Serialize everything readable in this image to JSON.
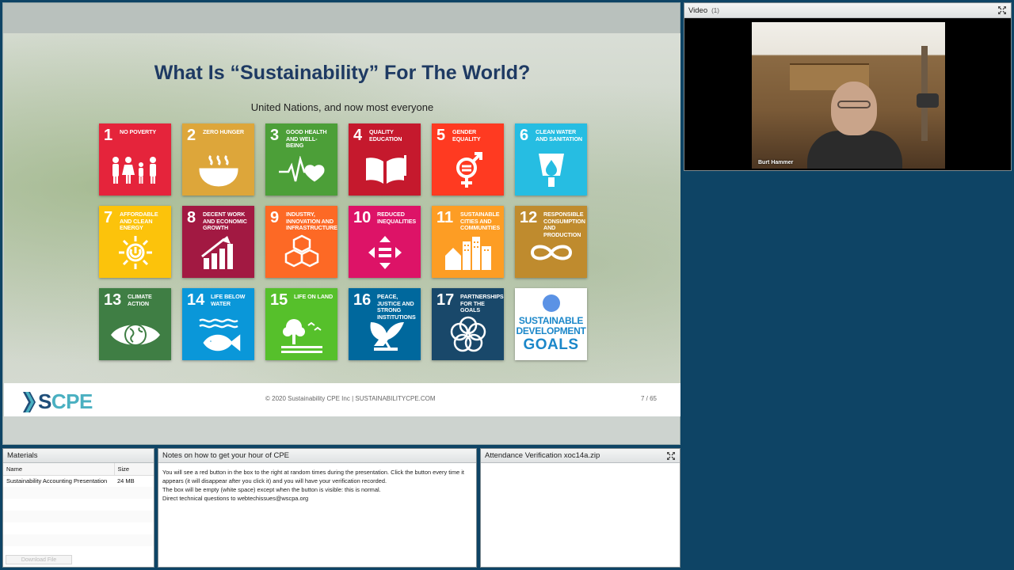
{
  "slide": {
    "title": "What Is “Sustainability” For The World?",
    "subtitle": "United Nations, and now most everyone",
    "sdgs": [
      {
        "num": "1",
        "label": "No Poverty",
        "color": "#e5243b",
        "icon": "family-icon"
      },
      {
        "num": "2",
        "label": "Zero Hunger",
        "color": "#dda63a",
        "icon": "bowl-icon"
      },
      {
        "num": "3",
        "label": "Good Health and Well-Being",
        "color": "#4c9f38",
        "icon": "heartbeat-icon"
      },
      {
        "num": "4",
        "label": "Quality Education",
        "color": "#c5192d",
        "icon": "book-icon"
      },
      {
        "num": "5",
        "label": "Gender Equality",
        "color": "#ff3a21",
        "icon": "gender-icon"
      },
      {
        "num": "6",
        "label": "Clean Water and Sanitation",
        "color": "#26bde2",
        "icon": "water-icon"
      },
      {
        "num": "7",
        "label": "Affordable and Clean Energy",
        "color": "#fcc30b",
        "icon": "sun-power-icon"
      },
      {
        "num": "8",
        "label": "Decent Work and Economic Growth",
        "color": "#a21942",
        "icon": "growth-chart-icon"
      },
      {
        "num": "9",
        "label": "Industry, Innovation and Infrastructure",
        "color": "#fd6925",
        "icon": "cubes-icon"
      },
      {
        "num": "10",
        "label": "Reduced Inequalities",
        "color": "#dd1367",
        "icon": "equality-arrows-icon"
      },
      {
        "num": "11",
        "label": "Sustainable Cities and Communities",
        "color": "#fd9d24",
        "icon": "city-icon"
      },
      {
        "num": "12",
        "label": "Responsible Consumption and Production",
        "color": "#bf8b2e",
        "icon": "infinity-icon"
      },
      {
        "num": "13",
        "label": "Climate Action",
        "color": "#3f7e44",
        "icon": "eye-globe-icon"
      },
      {
        "num": "14",
        "label": "Life Below Water",
        "color": "#0a97d9",
        "icon": "fish-icon"
      },
      {
        "num": "15",
        "label": "Life On Land",
        "color": "#56c02b",
        "icon": "tree-icon"
      },
      {
        "num": "16",
        "label": "Peace, Justice and Strong Institutions",
        "color": "#00689d",
        "icon": "dove-icon"
      },
      {
        "num": "17",
        "label": "Partnerships for the Goals",
        "color": "#19486a",
        "icon": "flower-rings-icon"
      }
    ],
    "sdg_logo": {
      "line1": "SUSTAINABLE",
      "line2": "DEVELOPMENT",
      "line3": "GOALS"
    },
    "footer": {
      "logo_s": "S",
      "logo_cpe": "CPE",
      "copyright": "© 2020 Sustainability CPE Inc |  SUSTAINABILITYCPE.COM",
      "page": "7 / 65"
    }
  },
  "video": {
    "title": "Video",
    "count": "(1)",
    "presenter": "Burt Hammer"
  },
  "materials": {
    "title": "Materials",
    "col_name": "Name",
    "col_size": "Size",
    "rows": [
      {
        "name": "Sustainability Accounting Presentation",
        "size": "24 MB"
      }
    ],
    "download_label": "Download File"
  },
  "notes": {
    "title": "Notes on how to get your hour of CPE",
    "lines": [
      "You will see a red button in the box to the right at random times during the presentation. Click the button every time it appears (it will disappear after you click it) and you will have your verification recorded.",
      "The box will be empty (white space) except when the button is visible: this is normal.",
      "Direct technical questions to webtechissues@wscpa.org"
    ]
  },
  "attendance": {
    "title": "Attendance Verification xoc14a.zip"
  }
}
